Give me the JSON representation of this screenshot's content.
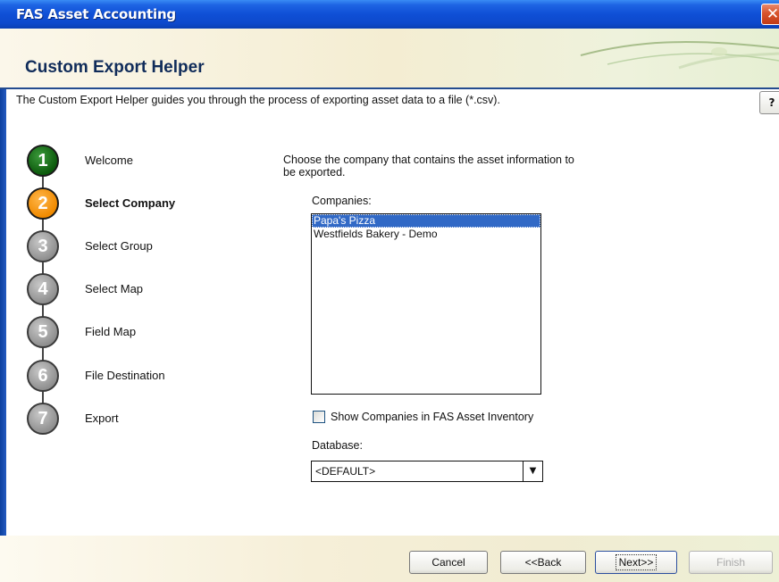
{
  "window": {
    "title": "FAS Asset Accounting",
    "close_glyph": "✕"
  },
  "header": {
    "heading": "Custom Export Helper"
  },
  "intro": "The Custom Export Helper guides you through the process of exporting asset data to a file (*.csv).",
  "help_glyph": "?",
  "steps": [
    {
      "number": "1",
      "label": "Welcome",
      "state": "complete"
    },
    {
      "number": "2",
      "label": "Select Company",
      "state": "current"
    },
    {
      "number": "3",
      "label": "Select Group",
      "state": "pending"
    },
    {
      "number": "4",
      "label": "Select Map",
      "state": "pending"
    },
    {
      "number": "5",
      "label": "Field Map",
      "state": "pending"
    },
    {
      "number": "6",
      "label": "File Destination",
      "state": "pending"
    },
    {
      "number": "7",
      "label": "Export",
      "state": "pending"
    }
  ],
  "main": {
    "prompt_line1": "Choose the company that contains the asset information to",
    "prompt_line2": "be exported.",
    "companies_label": "Companies:",
    "companies": [
      "Papa's Pizza",
      "Westfields Bakery - Demo"
    ],
    "selected_company": "Papa's Pizza",
    "show_companies_label": "Show Companies in FAS Asset Inventory",
    "show_companies_checked": false,
    "database_label": "Database:",
    "database_value": "<DEFAULT>",
    "dropdown_glyph": "▼"
  },
  "buttons": {
    "cancel": "Cancel",
    "back": "<<Back",
    "next": "Next>>",
    "finish": "Finish"
  },
  "colors": {
    "title_bar": "#0f4fd6",
    "step_complete": "#0c5a0c",
    "step_current": "#f08a00",
    "step_pending": "#8c8c8c",
    "selection": "#3169c6"
  }
}
